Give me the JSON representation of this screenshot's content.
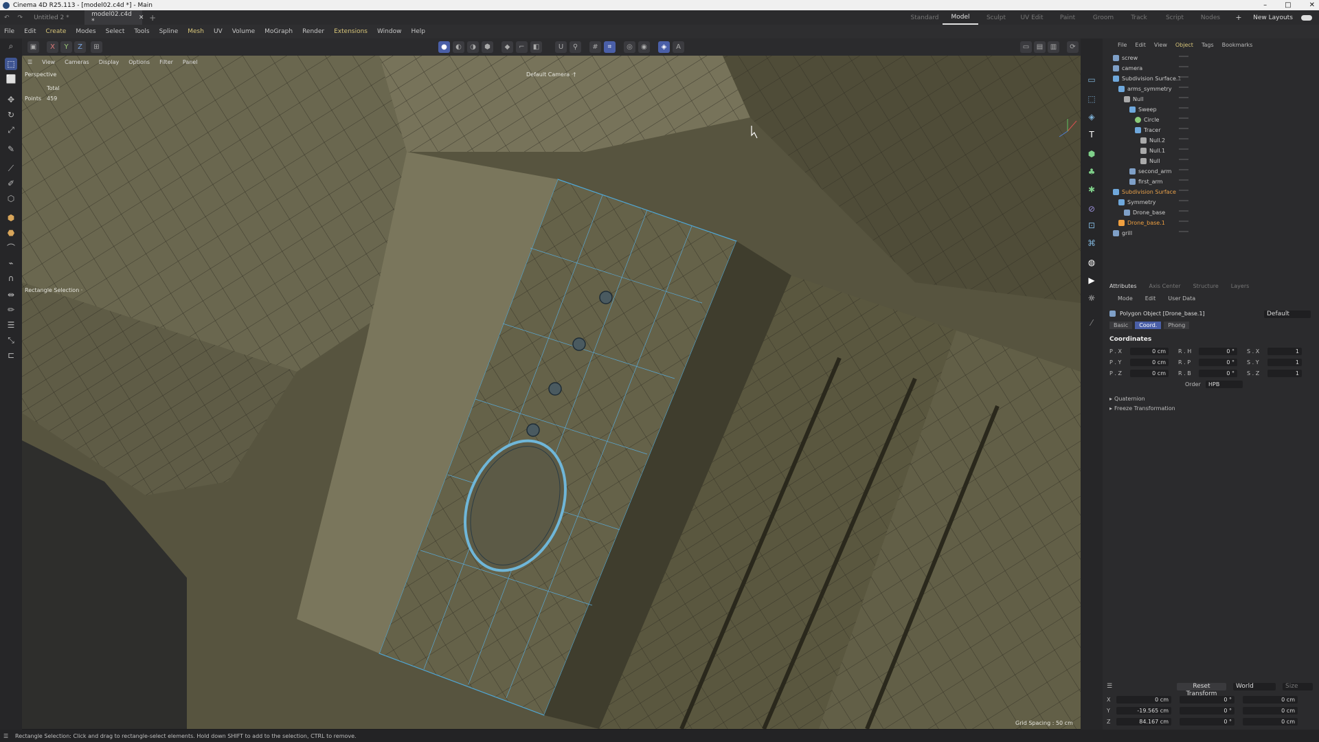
{
  "window": {
    "title": "Cinema 4D R25.113 - [model02.c4d *] - Main",
    "minimize": "–",
    "maximize": "□",
    "close": "✕"
  },
  "doc_tabs": [
    {
      "label": "Untitled 2 *"
    },
    {
      "label": "model02.c4d *"
    }
  ],
  "add_tab": "+",
  "layouts": [
    "Standard",
    "Model",
    "Sculpt",
    "UV Edit",
    "Paint",
    "Groom",
    "Track",
    "Script",
    "Nodes"
  ],
  "layout_active": "Model",
  "new_layouts": "New Layouts",
  "menu": [
    "File",
    "Edit",
    "Create",
    "Modes",
    "Select",
    "Tools",
    "Spline",
    "Mesh",
    "UV",
    "Volume",
    "MoGraph",
    "Render",
    "Extensions",
    "Window",
    "Help"
  ],
  "axis_lock": [
    "X",
    "Y",
    "Z"
  ],
  "viewport": {
    "menu": [
      "View",
      "Cameras",
      "Display",
      "Options",
      "Filter",
      "Panel"
    ],
    "perspective": "Perspective",
    "total_label": "Total",
    "points_label": "Points",
    "points_value": "459",
    "camera": "Default Camera ·†",
    "tool_hint": "Rectangle Selection ·",
    "grid_spacing": "Grid Spacing : 50 cm"
  },
  "object_manager": {
    "menu": [
      "File",
      "Edit",
      "View",
      "Object",
      "Tags",
      "Bookmarks"
    ],
    "items": [
      {
        "name": "screw",
        "color": "#7fa0c8"
      },
      {
        "name": "camera",
        "color": "#7fa0c8"
      },
      {
        "name": "Subdivision Surface.1",
        "color": "#6fa8dc"
      },
      {
        "name": "arms_symmetry",
        "color": "#6fa8dc"
      },
      {
        "name": "Null",
        "color": "#aaaaaa"
      },
      {
        "name": "Sweep",
        "color": "#6fa8dc"
      },
      {
        "name": "Circle",
        "color": "#8acb7a"
      },
      {
        "name": "Tracer",
        "color": "#6fa8dc"
      },
      {
        "name": "Null.2",
        "color": "#aaaaaa"
      },
      {
        "name": "Null.1",
        "color": "#aaaaaa"
      },
      {
        "name": "Null",
        "color": "#aaaaaa"
      },
      {
        "name": "second_arm",
        "color": "#7fa0c8"
      },
      {
        "name": "first_arm",
        "color": "#7fa0c8"
      },
      {
        "name": "Subdivision Surface",
        "color": "#e9a14a"
      },
      {
        "name": "Symmetry",
        "color": "#6fa8dc"
      },
      {
        "name": "Drone_base",
        "color": "#7fa0c8"
      },
      {
        "name": "Drone_base.1",
        "color": "#f0a040"
      },
      {
        "name": "grill",
        "color": "#7fa0c8"
      }
    ]
  },
  "attributes": {
    "tabs": [
      "Attributes",
      "Axis Center",
      "Structure",
      "Layers"
    ],
    "menu": [
      "Mode",
      "Edit",
      "User Data"
    ],
    "object_title": "Polygon Object [Drone_base.1]",
    "preset": "Default",
    "subtabs": [
      "Basic",
      "Coord.",
      "Phong"
    ],
    "section": "Coordinates",
    "rows": [
      {
        "p": "P . X",
        "pv": "0 cm",
        "r": "R . H",
        "rv": "0 °",
        "s": "S . X",
        "sv": "1"
      },
      {
        "p": "P . Y",
        "pv": "0 cm",
        "r": "R . P",
        "rv": "0 °",
        "s": "S . Y",
        "sv": "1"
      },
      {
        "p": "P . Z",
        "pv": "0 cm",
        "r": "R . B",
        "rv": "0 °",
        "s": "S . Z",
        "sv": "1"
      }
    ],
    "order_label": "Order",
    "order_value": "HPB",
    "quaternion": "Quaternion",
    "freeze": "Freeze Transformation"
  },
  "coordinates_manager": {
    "reset": "Reset Transform",
    "space": "World",
    "size": "Size",
    "rows": [
      {
        "axis": "X",
        "pos": "0 cm",
        "rot": "0 °",
        "size": "0 cm"
      },
      {
        "axis": "Y",
        "pos": "-19.565 cm",
        "rot": "0 °",
        "size": "0 cm"
      },
      {
        "axis": "Z",
        "pos": "84.167 cm",
        "rot": "0 °",
        "size": "0 cm"
      }
    ]
  },
  "status": "Rectangle Selection: Click and drag to rectangle-select elements. Hold down SHIFT to add to the selection, CTRL to remove."
}
